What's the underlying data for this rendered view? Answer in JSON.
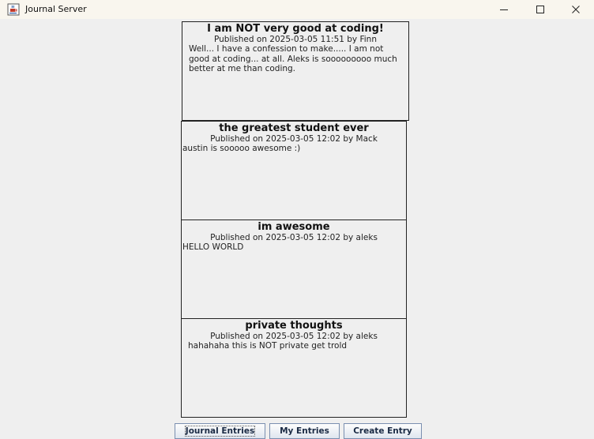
{
  "window": {
    "title": "Journal Server",
    "icon": "java-cup-icon",
    "controls": [
      "minimize-icon",
      "maximize-icon",
      "close-icon"
    ]
  },
  "entries": [
    {
      "title": "I am NOT very good at coding!",
      "meta": "Published on 2025-03-05 11:51 by Finn",
      "body": "Well... I have a confession to make..... I am not good at coding... at all. Aleks is sooooooooo much better at me than coding."
    },
    {
      "title": "the greatest student ever",
      "meta": "Published on 2025-03-05 12:02 by Mack",
      "body": "austin is sooooo awesome :)"
    },
    {
      "title": "im awesome",
      "meta": "Published on 2025-03-05 12:02 by aleks",
      "body": "HELLO WORLD"
    },
    {
      "title": "private thoughts",
      "meta": "Published on 2025-03-05 12:02 by aleks",
      "body": "hahahaha this is NOT private get trold"
    }
  ],
  "nav": {
    "journal_entries": "Journal Entries",
    "my_entries": "My Entries",
    "create_entry": "Create Entry",
    "focused": "journal_entries"
  }
}
